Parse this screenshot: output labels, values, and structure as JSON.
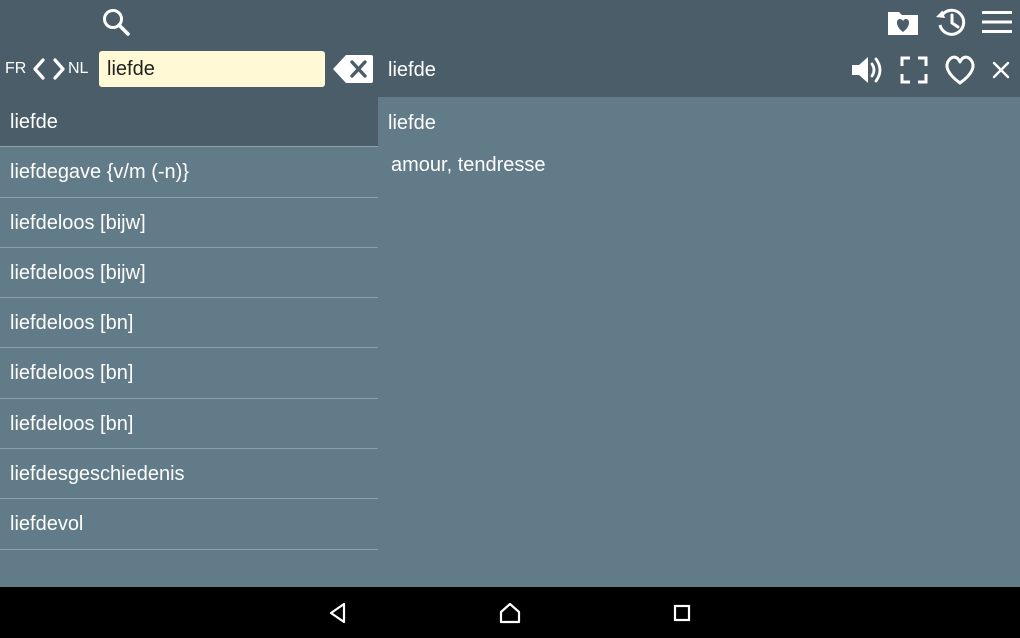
{
  "toolbar": {
    "search_icon": "search-icon",
    "favorites_icon": "heart-folder-icon",
    "history_icon": "history-icon",
    "menu_icon": "hamburger-menu-icon"
  },
  "search": {
    "lang_from": "FR",
    "lang_to": "NL",
    "value": "liefde",
    "placeholder": ""
  },
  "header": {
    "word": "liefde"
  },
  "word_list": [
    {
      "label": "liefde",
      "selected": true
    },
    {
      "label": "liefdegave {v/m (-n)}",
      "selected": false
    },
    {
      "label": "liefdeloos [bijw]",
      "selected": false
    },
    {
      "label": "liefdeloos [bijw]",
      "selected": false
    },
    {
      "label": "liefdeloos [bn]",
      "selected": false
    },
    {
      "label": "liefdeloos [bn]",
      "selected": false
    },
    {
      "label": "liefdeloos [bn]",
      "selected": false
    },
    {
      "label": "liefdesgeschiedenis",
      "selected": false
    },
    {
      "label": "liefdevol",
      "selected": false
    }
  ],
  "detail": {
    "headword": "liefde",
    "translation": "amour, tendresse"
  },
  "colors": {
    "topbar": "#4a5d69",
    "content": "#627b88",
    "selected_row": "#4a5d69",
    "input_bg": "#fff9d6",
    "navbar": "#000000"
  }
}
